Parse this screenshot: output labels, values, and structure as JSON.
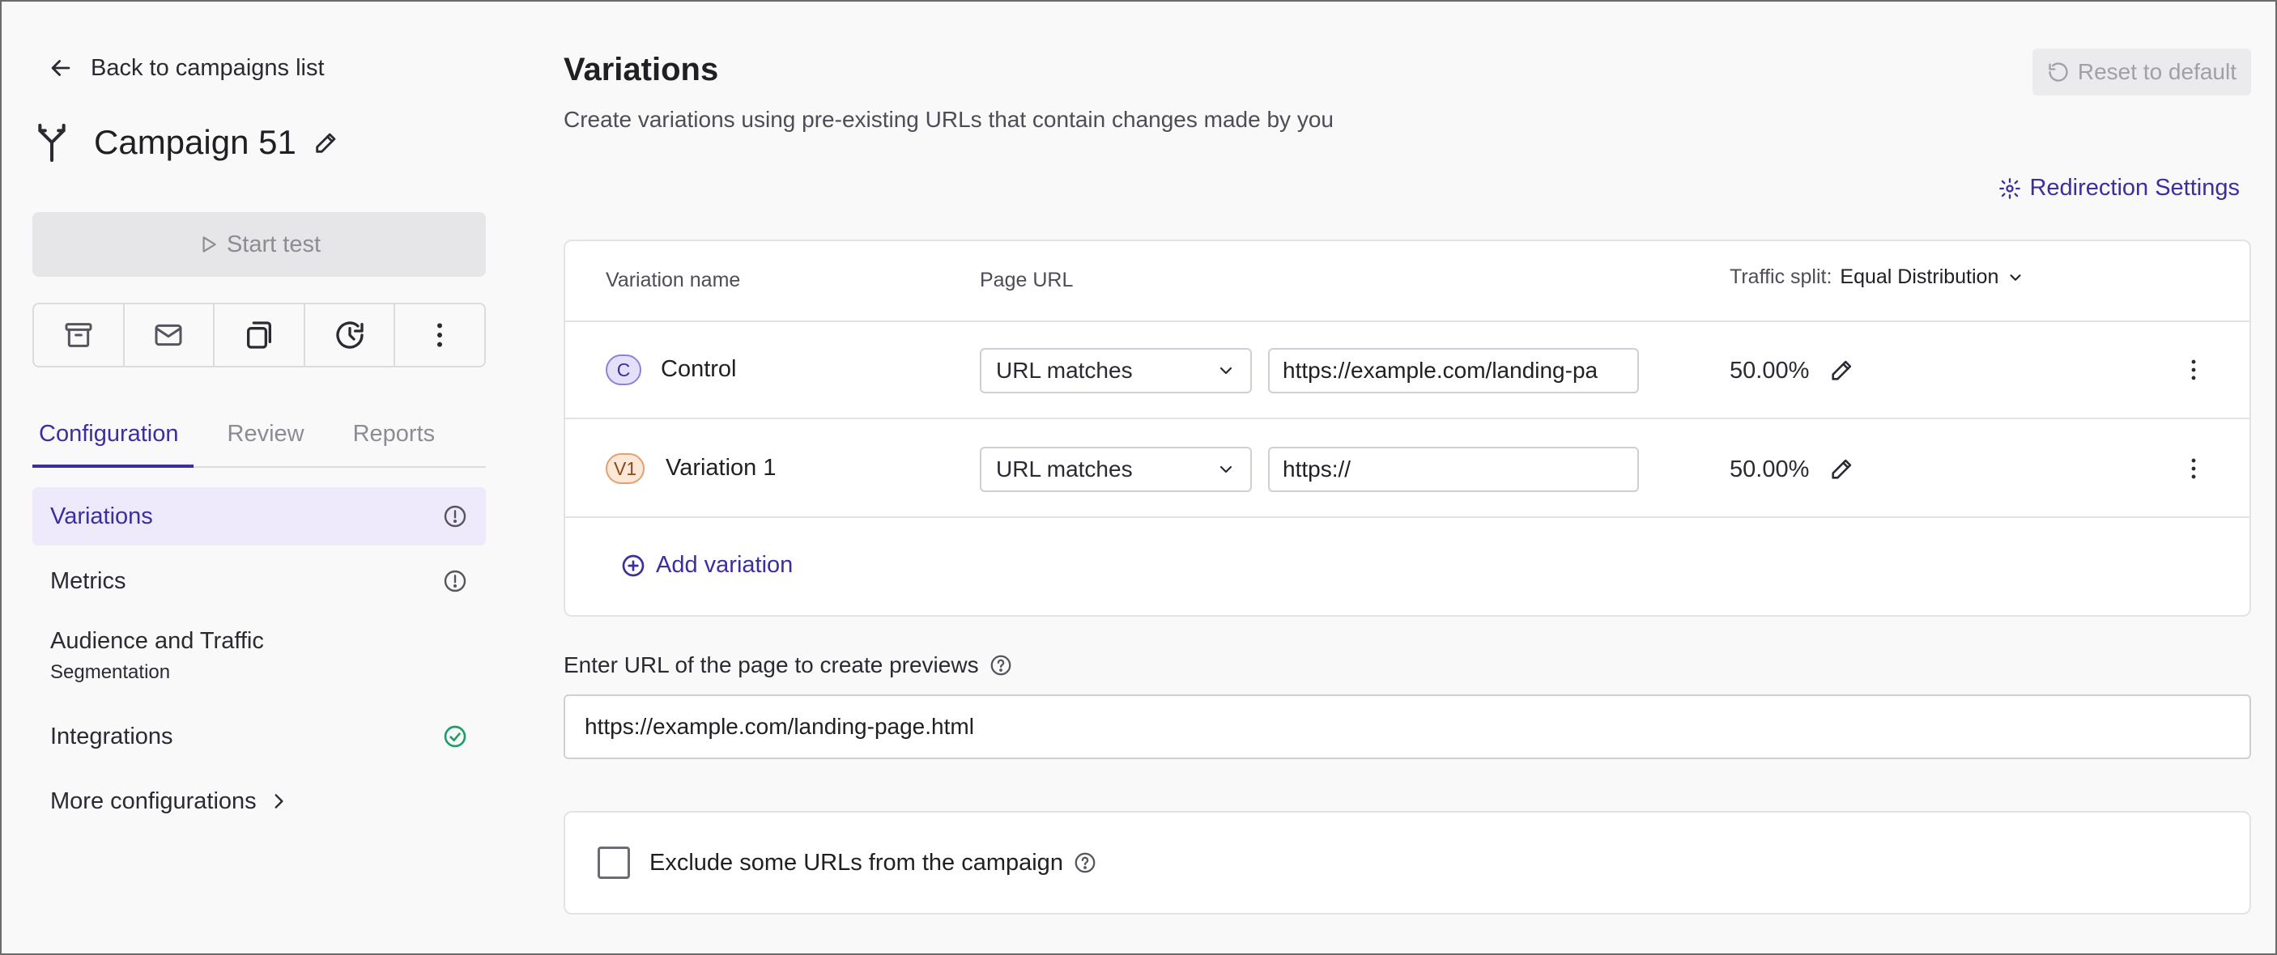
{
  "sidebar": {
    "back_label": "Back to campaigns list",
    "campaign_title": "Campaign 51",
    "start_test_label": "Start test",
    "toolbar_icons": [
      "archive-icon",
      "mail-icon",
      "duplicate-icon",
      "history-icon",
      "more-vertical-icon"
    ],
    "tabs": [
      {
        "label": "Configuration",
        "active": true
      },
      {
        "label": "Review",
        "active": false
      },
      {
        "label": "Reports",
        "active": false
      }
    ],
    "nav": {
      "variations": "Variations",
      "metrics": "Metrics",
      "audience_line1": "Audience and Traffic",
      "audience_line2": "Segmentation",
      "integrations": "Integrations",
      "more": "More configurations"
    }
  },
  "main": {
    "title": "Variations",
    "subtitle": "Create variations using pre-existing URLs that contain changes made by you",
    "reset_label": "Reset to default",
    "redirection_label": "Redirection Settings",
    "table": {
      "col_name": "Variation name",
      "col_url": "Page URL",
      "col_traffic": "Traffic split:",
      "traffic_mode": "Equal Distribution",
      "rows": [
        {
          "badge": "C",
          "name": "Control",
          "match": "URL matches",
          "url": "https://example.com/landing-pa",
          "split": "50.00%"
        },
        {
          "badge": "V1",
          "name": "Variation 1",
          "match": "URL matches",
          "url": "https://",
          "split": "50.00%"
        }
      ],
      "add_label": "Add variation"
    },
    "preview": {
      "label": "Enter URL of the page to create previews",
      "value": "https://example.com/landing-page.html"
    },
    "exclude": {
      "label": "Exclude some URLs from the campaign",
      "checked": false
    }
  },
  "colors": {
    "accent": "#3b2f9e",
    "active_bg": "#eeeafc",
    "success": "#1f9e6a"
  }
}
